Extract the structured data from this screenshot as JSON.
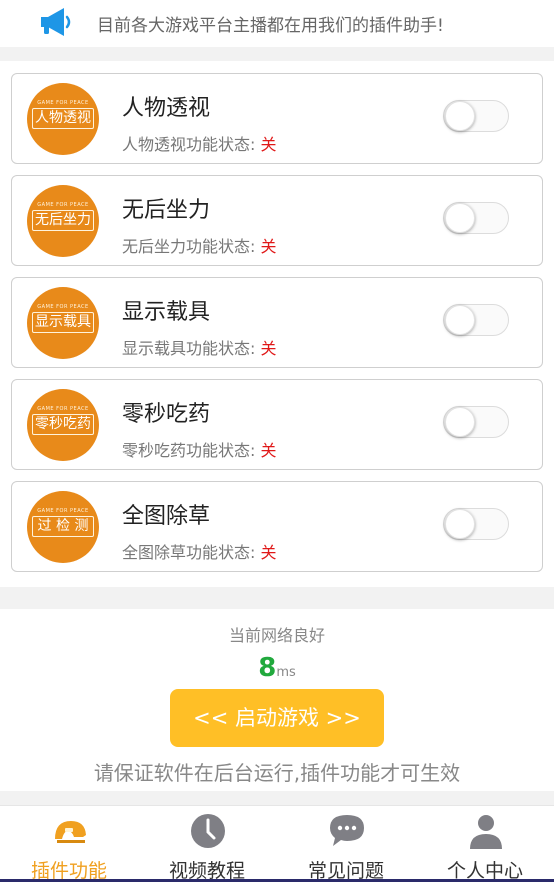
{
  "notice": {
    "text": "目前各大游戏平台主播都在用我们的插件助手!",
    "icon": "megaphone-icon"
  },
  "features": [
    {
      "title": "人物透视",
      "badge_text": "人物透视",
      "badge_small": "GAME FOR PEACE",
      "status_label": "人物透视功能状态:",
      "status_value": "关",
      "enabled": false
    },
    {
      "title": "无后坐力",
      "badge_text": "无后坐力",
      "badge_small": "GAME FOR PEACE",
      "status_label": "无后坐力功能状态:",
      "status_value": "关",
      "enabled": false
    },
    {
      "title": "显示载具",
      "badge_text": "显示载具",
      "badge_small": "GAME FOR PEACE",
      "status_label": "显示载具功能状态:",
      "status_value": "关",
      "enabled": false
    },
    {
      "title": "零秒吃药",
      "badge_text": "零秒吃药",
      "badge_small": "GAME FOR PEACE",
      "status_label": "零秒吃药功能状态:",
      "status_value": "关",
      "enabled": false
    },
    {
      "title": "全图除草",
      "badge_text": "过 检 测",
      "badge_small": "GAME FOR PEACE",
      "status_label": "全图除草功能状态:",
      "status_value": "关",
      "enabled": false
    }
  ],
  "network": {
    "status_text": "当前网络良好",
    "ping_value": "8",
    "ping_unit": "ms"
  },
  "launch_button": {
    "label": "<< 启动游戏 >>"
  },
  "hint": "请保证软件在后台运行,插件功能才可生效",
  "tabs": [
    {
      "label": "插件功能",
      "icon": "helmet-icon",
      "active": true
    },
    {
      "label": "视频教程",
      "icon": "clock-icon",
      "active": false
    },
    {
      "label": "常见问题",
      "icon": "chat-bubble-icon",
      "active": false
    },
    {
      "label": "个人中心",
      "icon": "user-icon",
      "active": false
    }
  ],
  "colors": {
    "accent": "#ffbf26",
    "badge": "#e88a1a",
    "off": "#e01818",
    "ping": "#21a93d",
    "active_tab": "#f0a020",
    "megaphone": "#1e96e6"
  }
}
